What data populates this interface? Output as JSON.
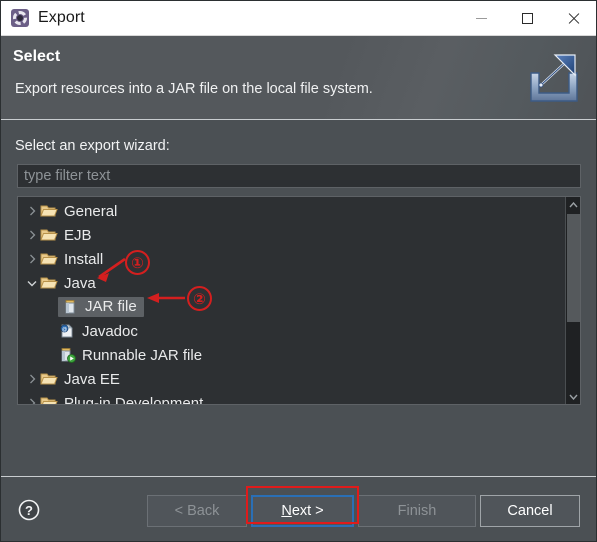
{
  "window": {
    "title": "Export",
    "icon": "eclipse-wizard-icon",
    "controls": {
      "minimize": "minimize-icon",
      "maximize": "maximize-icon",
      "close": "close-icon"
    }
  },
  "header": {
    "title": "Select",
    "description": "Export resources into a JAR file on the local file system.",
    "icon": "export-wizard-icon"
  },
  "main": {
    "section_label": "Select an export wizard:",
    "filter": {
      "value": "",
      "placeholder": "type filter text"
    },
    "tree": [
      {
        "label": "General",
        "icon": "folder-icon",
        "level": 0,
        "expander": "collapsed",
        "selected": false
      },
      {
        "label": "EJB",
        "icon": "folder-icon",
        "level": 0,
        "expander": "collapsed",
        "selected": false
      },
      {
        "label": "Install",
        "icon": "folder-icon",
        "level": 0,
        "expander": "collapsed",
        "selected": false
      },
      {
        "label": "Java",
        "icon": "folder-icon",
        "level": 0,
        "expander": "expanded",
        "selected": false
      },
      {
        "label": "JAR file",
        "icon": "jar-file-icon",
        "level": 1,
        "expander": "none",
        "selected": true
      },
      {
        "label": "Javadoc",
        "icon": "javadoc-icon",
        "level": 1,
        "expander": "none",
        "selected": false
      },
      {
        "label": "Runnable JAR file",
        "icon": "runnable-jar-icon",
        "level": 1,
        "expander": "none",
        "selected": false
      },
      {
        "label": "Java EE",
        "icon": "folder-icon",
        "level": 0,
        "expander": "collapsed",
        "selected": false
      },
      {
        "label": "Plug-in Development",
        "icon": "folder-icon",
        "level": 0,
        "expander": "collapsed",
        "selected": false
      }
    ],
    "scrollbar": {
      "up_arrow": "chevron-up-icon",
      "down_arrow": "chevron-down-icon"
    }
  },
  "footer": {
    "help_icon": "help-icon",
    "buttons": {
      "back": {
        "label": "< Back",
        "enabled": false
      },
      "next": {
        "label": "Next >",
        "mnemonic": "N",
        "rest": "ext >",
        "enabled": true,
        "focused": true
      },
      "finish": {
        "label": "Finish",
        "enabled": false
      },
      "cancel": {
        "label": "Cancel",
        "enabled": true
      }
    }
  },
  "annotations": [
    {
      "number": "①",
      "target": "Java",
      "style": "circled-number-with-arrow"
    },
    {
      "number": "②",
      "target": "JAR file",
      "style": "circled-number-with-arrow"
    },
    {
      "number": "",
      "target": "Next >",
      "style": "red-rectangle"
    }
  ],
  "colors": {
    "dialog_bg": "#4b5054",
    "header_bg": "#54585c",
    "tree_bg": "#2d3033",
    "titlebar_bg": "#ffffff",
    "annotation_red": "#d41f1f",
    "focus_blue": "#2a6fb5",
    "selection_grey": "#5d6165"
  }
}
